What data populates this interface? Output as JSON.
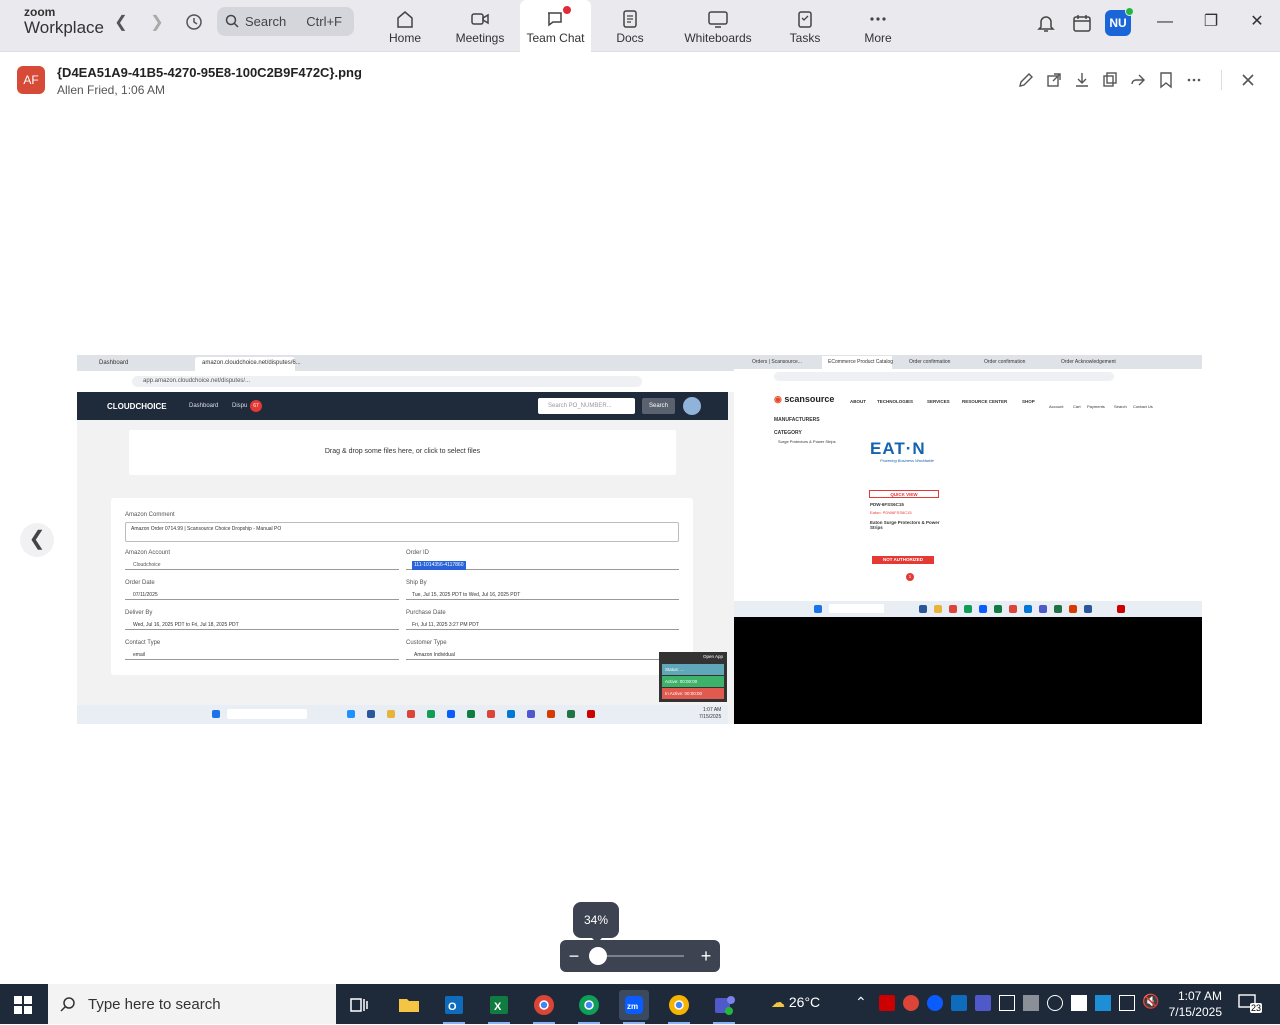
{
  "app": {
    "brand_top": "zoom",
    "brand_bottom": "Workplace"
  },
  "search": {
    "label": "Search",
    "shortcut": "Ctrl+F"
  },
  "tabs": [
    {
      "label": "Home",
      "icon": "home-icon"
    },
    {
      "label": "Meetings",
      "icon": "video-icon"
    },
    {
      "label": "Team Chat",
      "icon": "chat-icon",
      "active": true
    },
    {
      "label": "Docs",
      "icon": "doc-icon"
    },
    {
      "label": "Whiteboards",
      "icon": "whiteboard-icon"
    },
    {
      "label": "Tasks",
      "icon": "tasks-icon"
    },
    {
      "label": "More",
      "icon": "more-icon"
    }
  ],
  "user": {
    "initials": "NU"
  },
  "viewer": {
    "avatar_initials": "AF",
    "file_name": "{D4EA51A9-41B5-4270-95E8-100C2B9F472C}.png",
    "meta": "Allen Fried, 1:06 AM"
  },
  "zoom": {
    "level": "34%",
    "level_fraction": 0.34
  },
  "shot": {
    "left_tabs": [
      "Dashboard",
      "amazon.cloudchoice.net/disputes/6..."
    ],
    "left_url": "app.amazon.cloudchoice.net/disputes/...",
    "cc_brand": "CLOUDCHOICE",
    "cc_nav": [
      "Dashboard",
      "Dispu"
    ],
    "cc_badge": "67",
    "cc_search_placeholder": "Search PO_NUMBER...",
    "cc_search_btn": "Search",
    "dropzone": "Drag & drop some files here, or click to select files",
    "fields": [
      {
        "label": "Amazon Comment",
        "value": "Amazon Order 0714.99 | Scansource Choice Dropship - Manual PO"
      },
      {
        "label": "Amazon Account",
        "value": "Cloudchoice"
      },
      {
        "label": "Order ID",
        "value": "111-1014356-4117860"
      },
      {
        "label": "Order Date",
        "value": "07/11/2025"
      },
      {
        "label": "Ship By",
        "value": "Tue, Jul 15, 2025 PDT to Wed, Jul 16, 2025 PDT"
      },
      {
        "label": "Deliver By",
        "value": "Wed, Jul 16, 2025 PDT to Fri, Jul 18, 2025 PDT"
      },
      {
        "label": "Purchase Date",
        "value": "Fri, Jul 11, 2025 3:27 PM PDT"
      },
      {
        "label": "Contact Type",
        "value": "email"
      },
      {
        "label": "Customer Type",
        "value": "Amazon Individual"
      }
    ],
    "timer": {
      "header": "Open App",
      "rows": [
        "Status: ...",
        "Active: 00:00:00",
        "In Active: 00:00:00"
      ]
    },
    "left_clock": {
      "time": "1:07 AM",
      "date": "7/15/2025"
    },
    "right_tabs": [
      "Orders | Scansource...",
      "ECommerce Product Catalog",
      "Order confirmation",
      "Order confirmation",
      "Order Acknowledgement"
    ],
    "scan_logo": "scansource",
    "scan_nav": [
      "ABOUT",
      "TECHNOLOGIES",
      "SERVICES",
      "RESOURCE CENTER",
      "SHOP"
    ],
    "scan_user_nav": [
      "Account",
      "Cart",
      "Payments",
      "Search",
      "Contact Us"
    ],
    "filters": [
      "MANUFACTURERS",
      "CATEGORY",
      "Surge Protectors & Power Strips"
    ],
    "eaton": "EAT·N",
    "eaton_tag": "Powering Business Worldwide",
    "quick_view": "QUICK VIEW",
    "product_sku": "PDW-6FSS6C15",
    "product_mfr": "Eaton: PDW6FSS6C15",
    "product_cat": "Eaton Surge Protectors & Power Strips",
    "not_authorized": "NOT AUTHORIZED",
    "pager": "1"
  },
  "taskbar": {
    "search_placeholder": "Type here to search",
    "weather": "26°C",
    "time": "1:07 AM",
    "date": "7/15/2025",
    "notifications": "23"
  }
}
